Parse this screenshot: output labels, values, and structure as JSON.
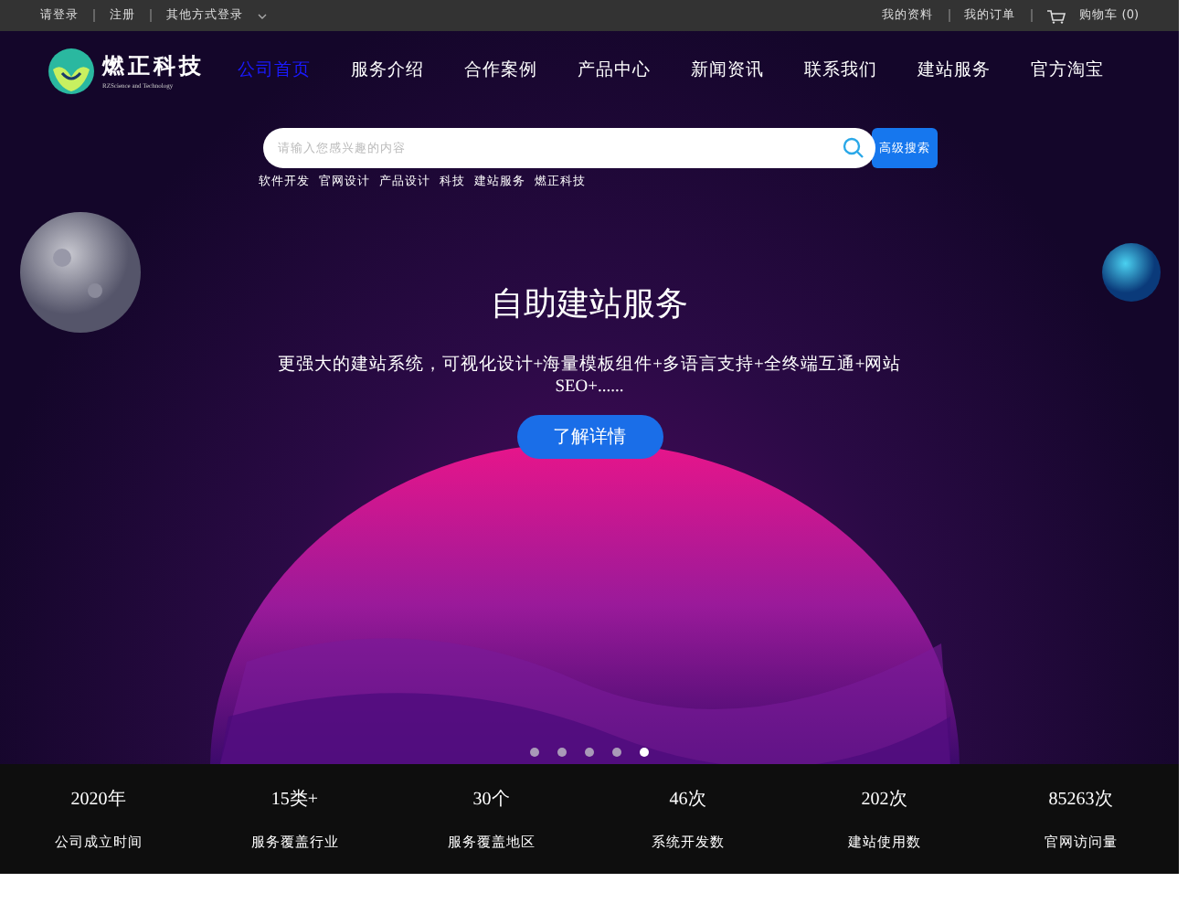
{
  "top_bar": {
    "left": [
      "请登录",
      "注册",
      "其他方式登录"
    ],
    "right": [
      "我的资料",
      "我的订单"
    ],
    "cart": "购物车 (0)"
  },
  "logo": {
    "name": "燃正科技",
    "subtitle": "RZScience and Technology"
  },
  "nav": [
    {
      "label": "公司首页",
      "selected": true
    },
    {
      "label": "服务介绍",
      "selected": false
    },
    {
      "label": "合作案例",
      "selected": false
    },
    {
      "label": "产品中心",
      "selected": false
    },
    {
      "label": "新闻资讯",
      "selected": false
    },
    {
      "label": "联系我们",
      "selected": false
    },
    {
      "label": "建站服务",
      "selected": false
    },
    {
      "label": "官方淘宝",
      "selected": false
    }
  ],
  "search": {
    "placeholder": "请输入您感兴趣的内容",
    "button": "高级搜索",
    "tags": [
      "软件开发",
      "官网设计",
      "产品设计",
      "科技",
      "建站服务",
      "燃正科技"
    ]
  },
  "hero": {
    "title": "自助建站服务",
    "description": "更强大的建站系统，可视化设计+海量模板组件+多语言支持+全终端互通+网站SEO+......",
    "button": "了解详情",
    "dots": [
      {
        "selected": false
      },
      {
        "selected": false
      },
      {
        "selected": false
      },
      {
        "selected": false
      },
      {
        "selected": true
      }
    ]
  },
  "stats": [
    {
      "value": "2020年",
      "label": "公司成立时间"
    },
    {
      "value": "15类+",
      "label": "服务覆盖行业"
    },
    {
      "value": "30个",
      "label": "服务覆盖地区"
    },
    {
      "value": "46次",
      "label": "系统开发数"
    },
    {
      "value": "202次",
      "label": "建站使用数"
    },
    {
      "value": "85263次",
      "label": "官网访问量"
    }
  ]
}
